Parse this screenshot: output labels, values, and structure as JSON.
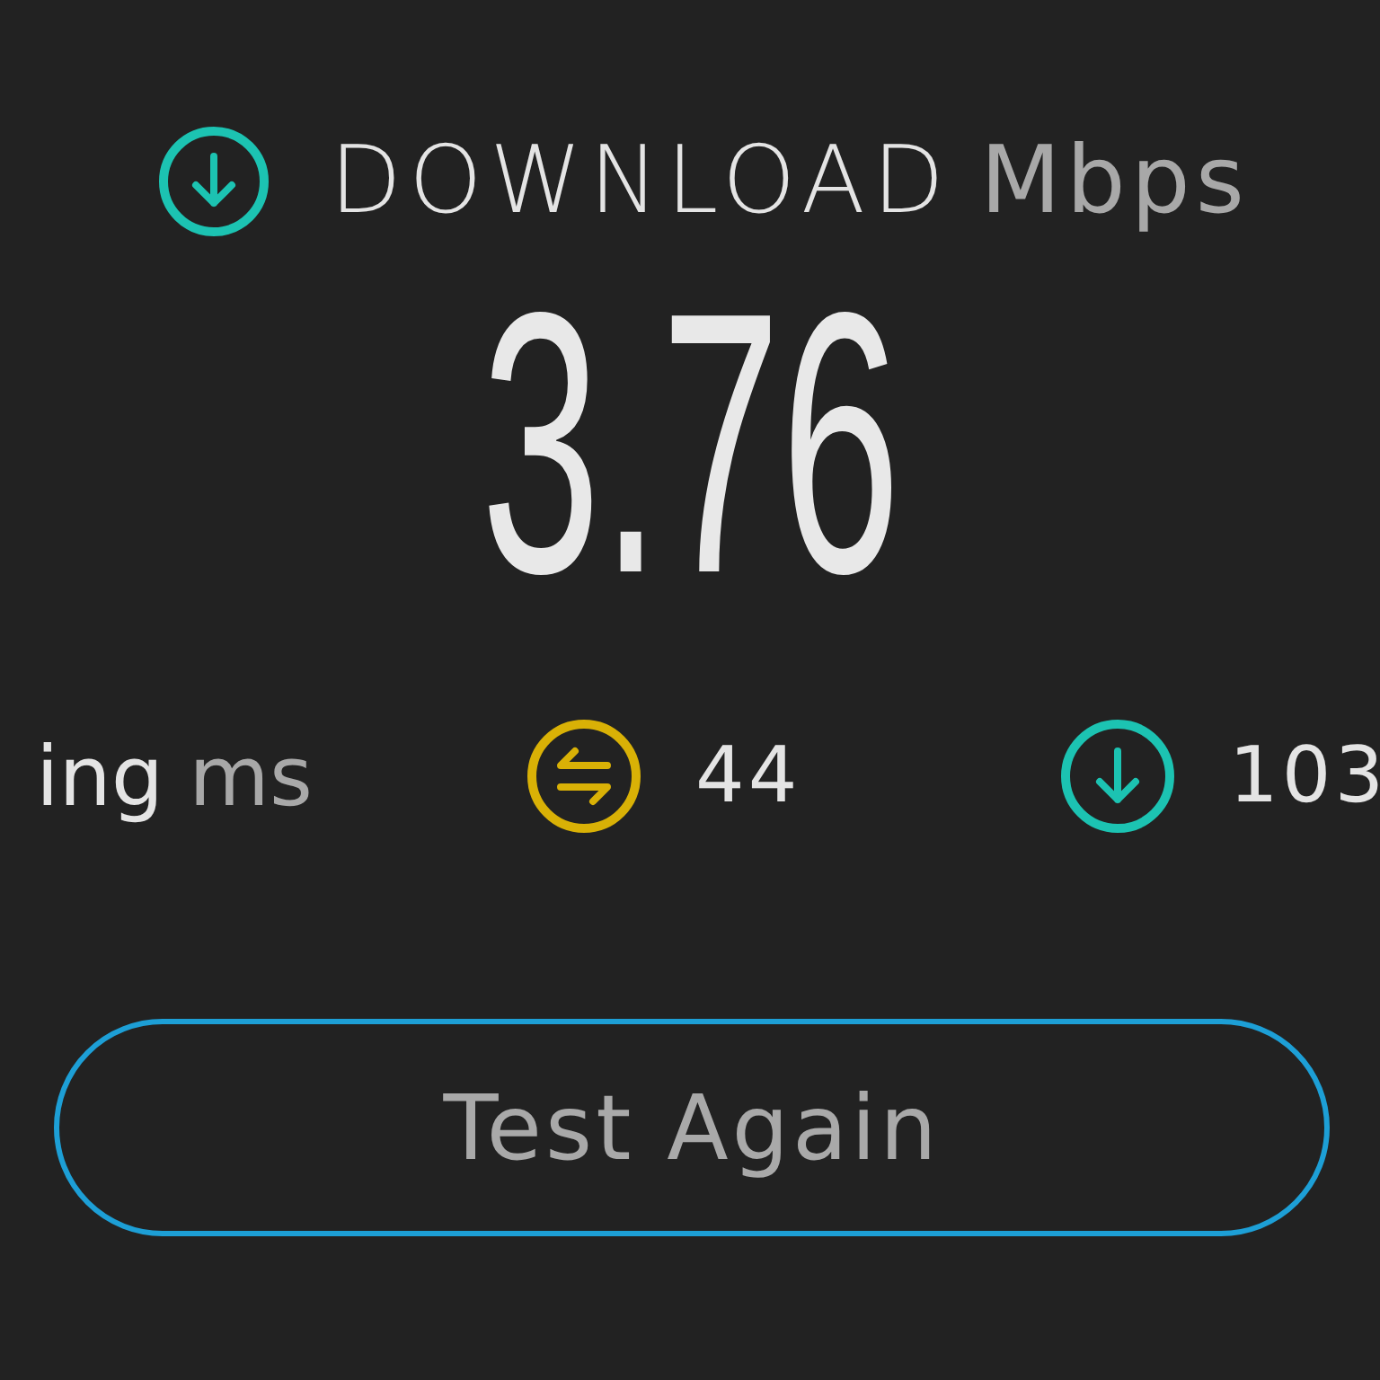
{
  "download": {
    "label": "DOWNLOAD",
    "unit": "Mbps",
    "value": "3.76"
  },
  "stats": {
    "label": "ing",
    "unit": "ms",
    "items": [
      {
        "kind": "ping",
        "value": "44"
      },
      {
        "kind": "download",
        "value": "103"
      }
    ]
  },
  "button": {
    "label": "Test Again"
  }
}
